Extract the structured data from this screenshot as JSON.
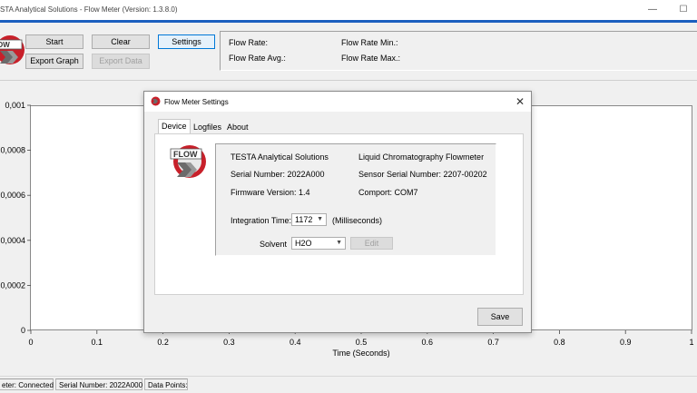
{
  "window": {
    "title": "STA Analytical Solutions - Flow Meter (Version: 1.3.8.0)",
    "minimize_glyph": "—",
    "maximize_glyph": "☐"
  },
  "toolbar": {
    "start_label": "Start",
    "clear_label": "Clear",
    "settings_label": "Settings",
    "export_graph_label": "Export Graph",
    "export_data_label": "Export Data"
  },
  "readouts": {
    "flow_rate": "Flow Rate:",
    "flow_rate_avg": "Flow Rate Avg.:",
    "flow_rate_min": "Flow Rate Min.:",
    "flow_rate_max": "Flow Rate Max.:"
  },
  "chart_data": {
    "type": "line",
    "x": [],
    "series": [],
    "xlabel": "Time (Seconds)",
    "ylabel": "",
    "xlim": [
      0,
      1
    ],
    "ylim": [
      0,
      0.001
    ],
    "xticks": [
      "0",
      "0.1",
      "0.2",
      "0.3",
      "0.4",
      "0.5",
      "0.6",
      "0.7",
      "0.8",
      "0.9",
      "1"
    ],
    "yticks": [
      "0",
      "0,0002",
      "0,0004",
      "0,0006",
      "0,0008",
      "0,001"
    ],
    "grid": false
  },
  "status": {
    "connection": "eter: Connected",
    "serial": "Serial Number: 2022A000",
    "data_points": "Data Points:"
  },
  "dialog": {
    "title": "Flow Meter Settings",
    "close_glyph": "✕",
    "tabs": [
      "Device",
      "Logfiles",
      "About"
    ],
    "logo_text": "FLOW",
    "company": "TESTA Analytical Solutions",
    "product": "Liquid Chromatography Flowmeter",
    "serial_number": "Serial Number: 2022A000",
    "sensor_serial": "Sensor Serial Number: 2207-00202",
    "firmware": "Firmware Version: 1.4",
    "comport": "Comport: COM7",
    "integration_label": "Integration Time:",
    "integration_value": "1172",
    "integration_unit": "(Milliseconds)",
    "solvent_label": "Solvent",
    "solvent_value": "H2O",
    "edit_label": "Edit",
    "save_label": "Save"
  },
  "colors": {
    "accent": "#1c5fbf",
    "logo_red": "#c8202a",
    "logo_gray": "#6b6b6b"
  }
}
